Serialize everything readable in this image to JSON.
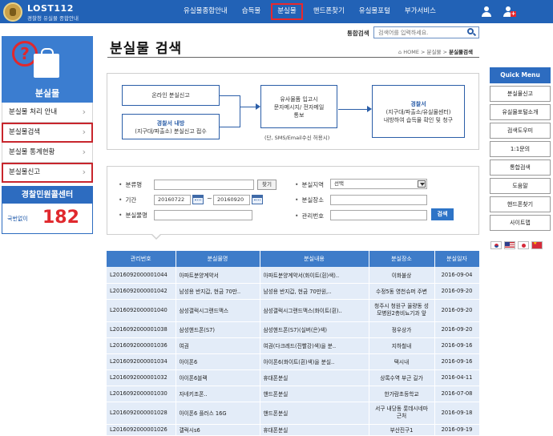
{
  "header": {
    "logo_name": "LOST112",
    "logo_sub": "경찰청 유실물 종합안내",
    "nav": [
      "유실물종합안내",
      "습득물",
      "분실물",
      "핸드폰찾기",
      "유실물포털",
      "부가서비스"
    ],
    "active_nav": "분실물"
  },
  "search": {
    "label": "통합검색",
    "placeholder": "검색어를 입력하세요."
  },
  "sidebar": {
    "title": "분실물",
    "items": [
      "분실물 처리 안내",
      "분실물검색",
      "분실물 통계현황",
      "분실물신고"
    ],
    "call_title": "경찰민원콜센터",
    "call_small": "국번없이",
    "call_number": "182"
  },
  "page": {
    "title": "분실물 검색",
    "breadcrumb_home": "HOME",
    "breadcrumb_mid": "분실물",
    "breadcrumb_current": "분실물검색"
  },
  "flow": {
    "box1": "온라인 분실신고",
    "box2_title": "경찰서 내방",
    "box2_sub": "(지구대/파출소) 분실신고 접수",
    "box3_line1": "유사물품 입고시",
    "box3_line2": "문자메시지/ 전자메일",
    "box3_line3": "통보",
    "note": "(단, SMS/Email수신 허용시)",
    "box4_title": "경찰서",
    "box4_line1": "(지구대/파출소/유실물센터)",
    "box4_line2": "내방하여 습득물 확인 및 청구"
  },
  "form": {
    "category_label": "분류명",
    "find_button": "찾기",
    "region_label": "분실지역",
    "region_value": "선택",
    "period_label": "기간",
    "date_from": "20160722",
    "date_sep": "~",
    "date_to": "20160920",
    "place_label": "분실장소",
    "item_label": "분실물명",
    "manage_label": "관리번호",
    "search_button": "검색"
  },
  "table": {
    "headers": [
      "관리번호",
      "분실물명",
      "분실내용",
      "분실장소",
      "분실일자"
    ],
    "rows": [
      [
        "L2016092000001044",
        "아파트분양계약서",
        "아파트분양계약서(화이트(흰)색)..",
        "이화불상",
        "2016-09-04"
      ],
      [
        "L2016092000001042",
        "남성용 반지갑, 현금 70만..",
        "남성용 반지갑, 현금 70만원,..",
        "수정5동 영천슈퍼 주변",
        "2016-09-20"
      ],
      [
        "L2016092000001040",
        "삼성갤럭시그랜드맥스",
        "삼성갤럭시그랜드맥스(화이트(흰)..",
        "청주시 청원구 율량동 성모병원2층비뇨기과 앞",
        "2016-09-20"
      ],
      [
        "L2016092000001038",
        "삼성핸드폰(S7)",
        "삼성핸드폰(S7)(실버(은)색)",
        "정우상가",
        "2016-09-20"
      ],
      [
        "L2016092000001036",
        "여권",
        "여권(다크레드(진빨강)색)을 분..",
        "지하철내",
        "2016-09-16"
      ],
      [
        "L2016092000001034",
        "아이폰6",
        "아이폰6(화이트(흰)색)을 분실..",
        "택시내",
        "2016-09-16"
      ],
      [
        "L2016092000001032",
        "아이폰6블랙",
        "휴대폰분실",
        "상록수역 부근 길가",
        "2016-04-11"
      ],
      [
        "L2016092000001030",
        "자네키조폰..",
        "핸드폰분실",
        "한가람초등학교",
        "2016-07-08"
      ],
      [
        "L2016092000001028",
        "아이폰6 플러스 16G",
        "핸드폰분실",
        "서구 내당동 롯데시네마 근처",
        "2016-09-18"
      ],
      [
        "L2016092000001026",
        "갤럭시s6",
        "휴대폰분실",
        "부산진구1",
        "2016-09-19"
      ]
    ]
  },
  "quick_menu": {
    "title": "Quick Menu",
    "items": [
      "분실물신고",
      "유실물포털소개",
      "검색도우미",
      "1:1문의",
      "통합검색",
      "도움말",
      "핸드폰찾기",
      "사이트맵"
    ]
  },
  "colors": {
    "brand_blue": "#2262b6",
    "highlight_red": "#e8282d",
    "table_header": "#3e7cc9",
    "table_cell": "#e3ecf8"
  }
}
